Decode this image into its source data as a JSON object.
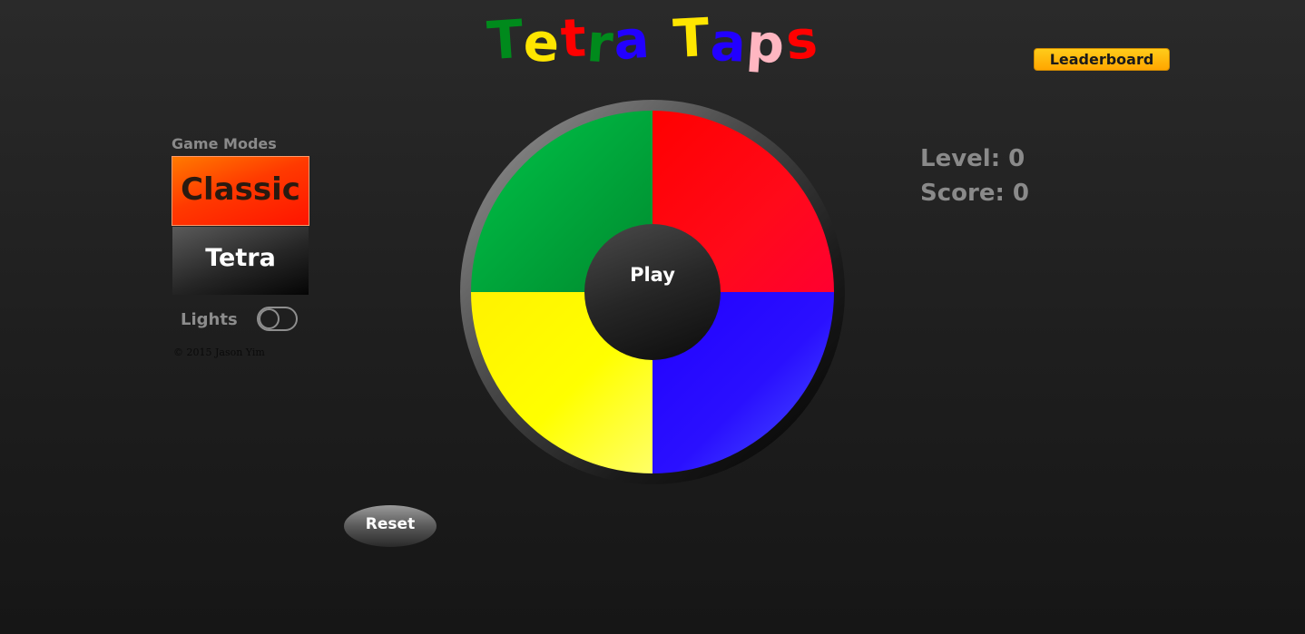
{
  "title": {
    "word1": [
      {
        "char": "T",
        "color": "#008a1c"
      },
      {
        "char": "e",
        "color": "#ffe600"
      },
      {
        "char": "t",
        "color": "#ff0000"
      },
      {
        "char": "r",
        "color": "#008a1c"
      },
      {
        "char": "a",
        "color": "#2200ff"
      }
    ],
    "word2": [
      {
        "char": "T",
        "color": "#ffe600"
      },
      {
        "char": "a",
        "color": "#2200ff"
      },
      {
        "char": "p",
        "color": "#ffb6c1"
      },
      {
        "char": "s",
        "color": "#ff0000"
      }
    ]
  },
  "header": {
    "leaderboard_label": "Leaderboard"
  },
  "sidebar": {
    "modes_heading": "Game Modes",
    "modes": [
      {
        "label": "Classic",
        "selected": true
      },
      {
        "label": "Tetra",
        "selected": false
      }
    ],
    "lights_label": "Lights",
    "lights_on": false,
    "copyright": "© 2015 Jason Yim"
  },
  "board": {
    "play_label": "Play",
    "quadrants": [
      {
        "name": "green",
        "color": "#00a43a"
      },
      {
        "name": "red",
        "color": "#ff0010"
      },
      {
        "name": "yellow",
        "color": "#ffff00"
      },
      {
        "name": "blue",
        "color": "#2a10ff"
      }
    ]
  },
  "stats": {
    "level_label": "Level: 0",
    "score_label": "Score: 0"
  },
  "controls": {
    "reset_label": "Reset"
  }
}
